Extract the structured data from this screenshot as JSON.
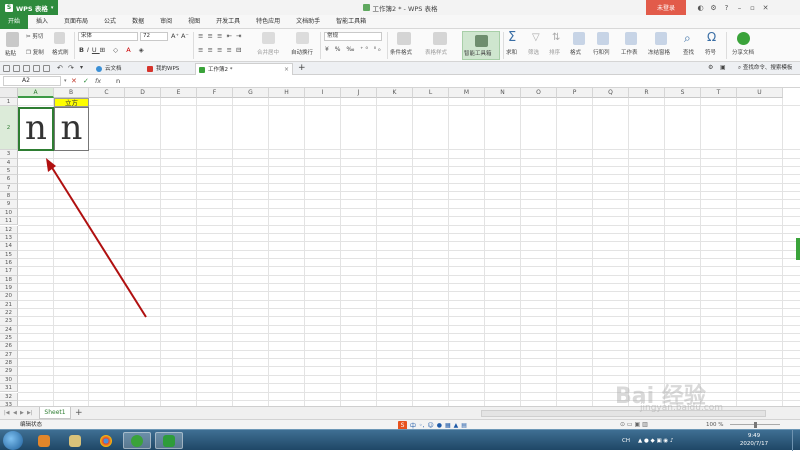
{
  "app": {
    "name": "WPS 表格",
    "window_title": "工作簿2 * - WPS 表格",
    "login_label": "未登录"
  },
  "menu_tabs": [
    "开始",
    "插入",
    "页面布局",
    "公式",
    "数据",
    "审阅",
    "视图",
    "开发工具",
    "特色应用",
    "文档助手",
    "智能工具箱"
  ],
  "ribbon": {
    "paste": "粘贴",
    "cut": "剪切",
    "copy": "复制",
    "format_painter": "格式刷",
    "font_name": "宋体",
    "font_size": "72",
    "merge_center": "合并居中",
    "wrap_text": "自动换行",
    "number_format": "常规",
    "conditional_format": "条件格式",
    "table_style": "表格样式",
    "smart_toolbox": "智能工具箱",
    "sum": "求和",
    "filter": "筛选",
    "sort": "排序",
    "format": "格式",
    "row_col": "行和列",
    "worksheet": "工作表",
    "freeze": "冻结窗格",
    "find": "查找",
    "symbol": "符号",
    "share": "分享文档"
  },
  "doc_tabs": [
    "云文档",
    "我的WPS",
    "工作簿2 *"
  ],
  "search_cmd": "查找命令、搜索模板",
  "formula_bar": {
    "name_box": "A2",
    "fx": "fx",
    "value": "n"
  },
  "columns": [
    "A",
    "B",
    "C",
    "D",
    "E",
    "F",
    "G",
    "H",
    "I",
    "J",
    "K",
    "L",
    "M",
    "N",
    "O",
    "P",
    "Q",
    "R",
    "S",
    "T",
    "U"
  ],
  "rows": [
    "1",
    "2",
    "3",
    "4",
    "5",
    "6",
    "7",
    "8",
    "9",
    "10",
    "11",
    "12",
    "13",
    "14",
    "15",
    "16",
    "17",
    "18",
    "19",
    "20",
    "21",
    "22",
    "23",
    "24",
    "25",
    "26",
    "27",
    "28",
    "29",
    "30",
    "31",
    "32",
    "33",
    "34",
    "35",
    "36"
  ],
  "cells": {
    "B1": "立方",
    "A2": "n",
    "B2": "n"
  },
  "sheet_tabs": [
    "Sheet1"
  ],
  "status": {
    "mode": "编辑状态",
    "zoom": "100 %"
  },
  "ime": {
    "logo": "S",
    "lang": "中"
  },
  "taskbar": {
    "tray_lang": "CH",
    "time": "9:49",
    "date": "2020/7/17"
  },
  "watermark": {
    "text": "Bai 经验",
    "url": "jingyan.baidu.com"
  },
  "colors": {
    "accent": "#2e8b3d",
    "header_fill": "#ffff00",
    "arrow": "#b01010",
    "login": "#e25b4a"
  }
}
